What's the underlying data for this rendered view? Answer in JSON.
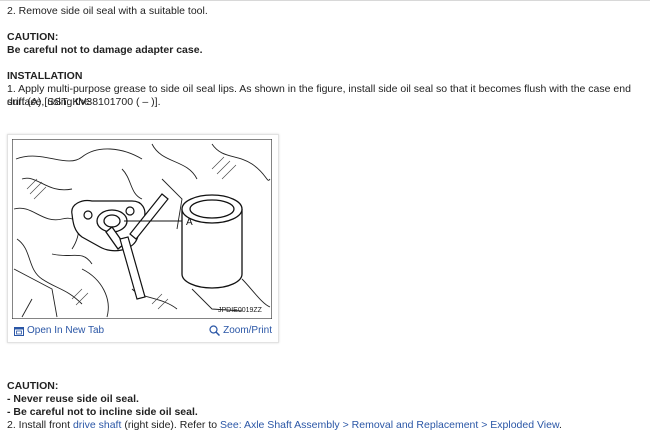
{
  "step_remove": "2. Remove side oil seal with a suitable tool.",
  "caution1": {
    "heading": "CAUTION:",
    "text": "Be careful not to damage adapter case."
  },
  "installation": {
    "heading": "INSTALLATION",
    "step1_line1": "1. Apply multi-purpose grease to side oil seal lips. As shown in the figure, install side oil seal so that it becomes flush with the case end surface, using the",
    "step1_line2": "drift (A) [SST: KV38101700 ( – )]."
  },
  "figure": {
    "callout": "A",
    "code": "JPDIE0019ZZ",
    "open_tab_label": "Open In New Tab",
    "zoom_label": "Zoom/Print"
  },
  "caution2": {
    "heading": "CAUTION:",
    "items": [
      "-  Never reuse side oil seal.",
      "-  Be careful not to incline side oil seal."
    ]
  },
  "step2": {
    "prefix": "2. Install front ",
    "link1": "drive shaft",
    "middle": " (right side). Refer to ",
    "link2": "See: Axle Shaft Assembly > Removal and Replacement > Exploded View",
    "suffix": "."
  },
  "colors": {
    "link": "#2a56a6",
    "text": "#222222"
  }
}
